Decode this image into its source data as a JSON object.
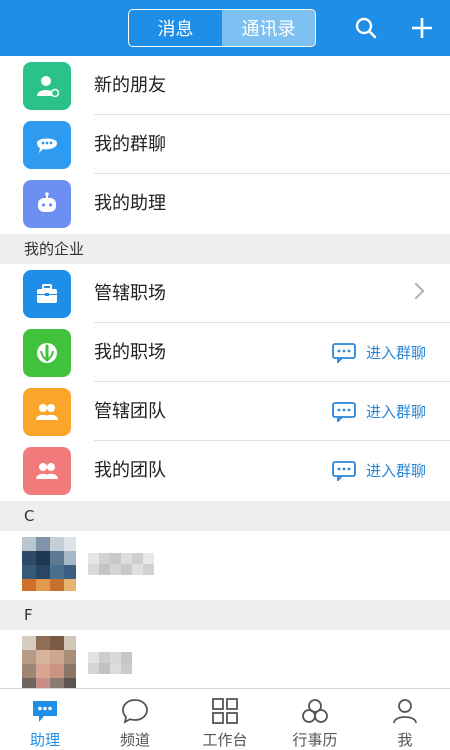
{
  "header": {
    "tabs": [
      {
        "label": "消息",
        "active": false
      },
      {
        "label": "通讯录",
        "active": true
      }
    ],
    "search_icon": "search-icon",
    "add_icon": "plus-icon"
  },
  "top_list": [
    {
      "label": "新的朋友",
      "icon": "new-friend-icon",
      "color": "#2bc28a"
    },
    {
      "label": "我的群聊",
      "icon": "group-chat-icon",
      "color": "#2f9bf0"
    },
    {
      "label": "我的助理",
      "icon": "robot-assistant-icon",
      "color": "#6e8ff2"
    }
  ],
  "enterprise": {
    "title": "我的企业",
    "items": [
      {
        "label": "管辖职场",
        "icon": "briefcase-icon",
        "color": "#1f8ee8"
      },
      {
        "label": "我的职场",
        "icon": "workplace-icon",
        "color": "#41c23c",
        "action": "进入群聊"
      },
      {
        "label": "管辖团队",
        "icon": "team-icon",
        "color": "#fba52a",
        "action": "进入群聊"
      },
      {
        "label": "我的团队",
        "icon": "my-team-icon",
        "color": "#f37a7a",
        "action": "进入群聊"
      }
    ]
  },
  "contacts": [
    {
      "letter": "C"
    },
    {
      "letter": "F"
    }
  ],
  "tabbar": {
    "items": [
      {
        "label": "助理",
        "icon": "assistant-icon",
        "active": true
      },
      {
        "label": "频道",
        "icon": "channel-icon",
        "active": false
      },
      {
        "label": "工作台",
        "icon": "workbench-icon",
        "active": false
      },
      {
        "label": "行事历",
        "icon": "calendar-icon",
        "active": false
      },
      {
        "label": "我",
        "icon": "profile-icon",
        "active": false
      }
    ]
  },
  "colors": {
    "brand": "#1f8ee8",
    "link": "#2a86d6",
    "section_bg": "#eeeeee"
  }
}
